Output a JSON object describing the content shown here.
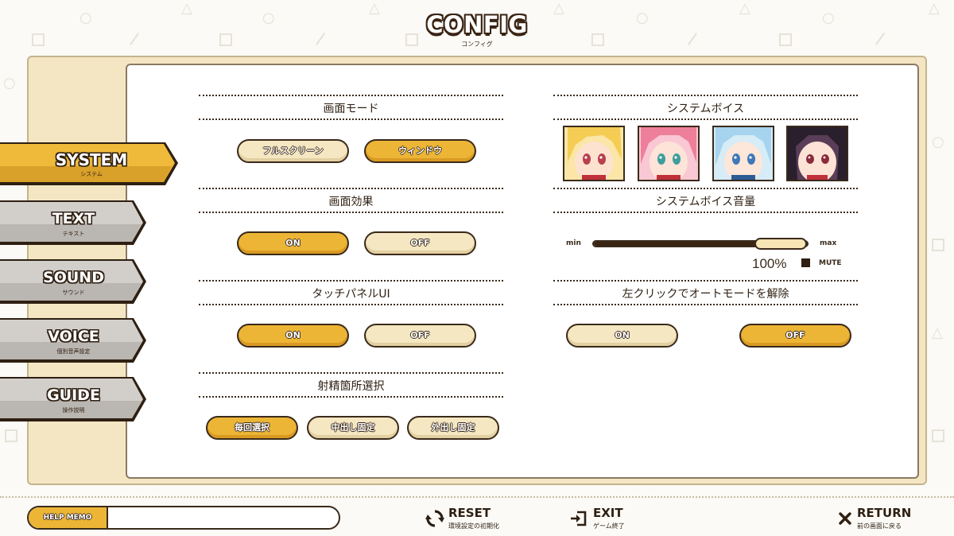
{
  "header": {
    "title": "CONFIG",
    "subtitle": "コンフィグ"
  },
  "sidebar": {
    "items": [
      {
        "label": "SYSTEM",
        "sub": "システム",
        "active": true
      },
      {
        "label": "TEXT",
        "sub": "テキスト",
        "active": false
      },
      {
        "label": "SOUND",
        "sub": "サウンド",
        "active": false
      },
      {
        "label": "VOICE",
        "sub": "個別音声設定",
        "active": false
      },
      {
        "label": "GUIDE",
        "sub": "操作説明",
        "active": false
      }
    ]
  },
  "left": {
    "screen_mode": {
      "title": "画面モード",
      "options": [
        "フルスクリーン",
        "ウィンドウ"
      ],
      "selected": "ウィンドウ"
    },
    "screen_effect": {
      "title": "画面効果",
      "options": [
        "ON",
        "OFF"
      ],
      "selected": "ON"
    },
    "touch_panel": {
      "title": "タッチパネルUI",
      "options": [
        "ON",
        "OFF"
      ],
      "selected": "ON"
    },
    "ejaculation": {
      "title": "射精箇所選択",
      "options": [
        "毎回選択",
        "中出し固定",
        "外出し固定"
      ],
      "selected": "毎回選択"
    }
  },
  "right": {
    "system_voice": {
      "title": "システムボイス",
      "characters": [
        "character-blonde",
        "character-pink",
        "character-blue",
        "character-black"
      ]
    },
    "system_voice_volume": {
      "title": "システムボイス音量",
      "min_label": "min",
      "max_label": "max",
      "value_text": "100%",
      "level": 1.0,
      "mute_label": "MUTE"
    },
    "left_click_auto": {
      "title": "左クリックでオートモードを解除",
      "options": [
        "ON",
        "OFF"
      ],
      "selected": "OFF"
    }
  },
  "footer": {
    "help_label": "HELP MEMO",
    "help_text": "",
    "reset": {
      "label": "RESET",
      "sub": "環境設定の初期化",
      "icon": "reset-icon"
    },
    "exit": {
      "label": "EXIT",
      "sub": "ゲーム終了",
      "icon": "exit-icon"
    },
    "return": {
      "label": "RETURN",
      "sub": "前の画面に戻る",
      "icon": "close-icon"
    }
  },
  "colors": {
    "accent": "#ecb536",
    "inactive": "#f5e7c2",
    "frame": "#f4e6c3",
    "outline": "#3a2a1a"
  }
}
